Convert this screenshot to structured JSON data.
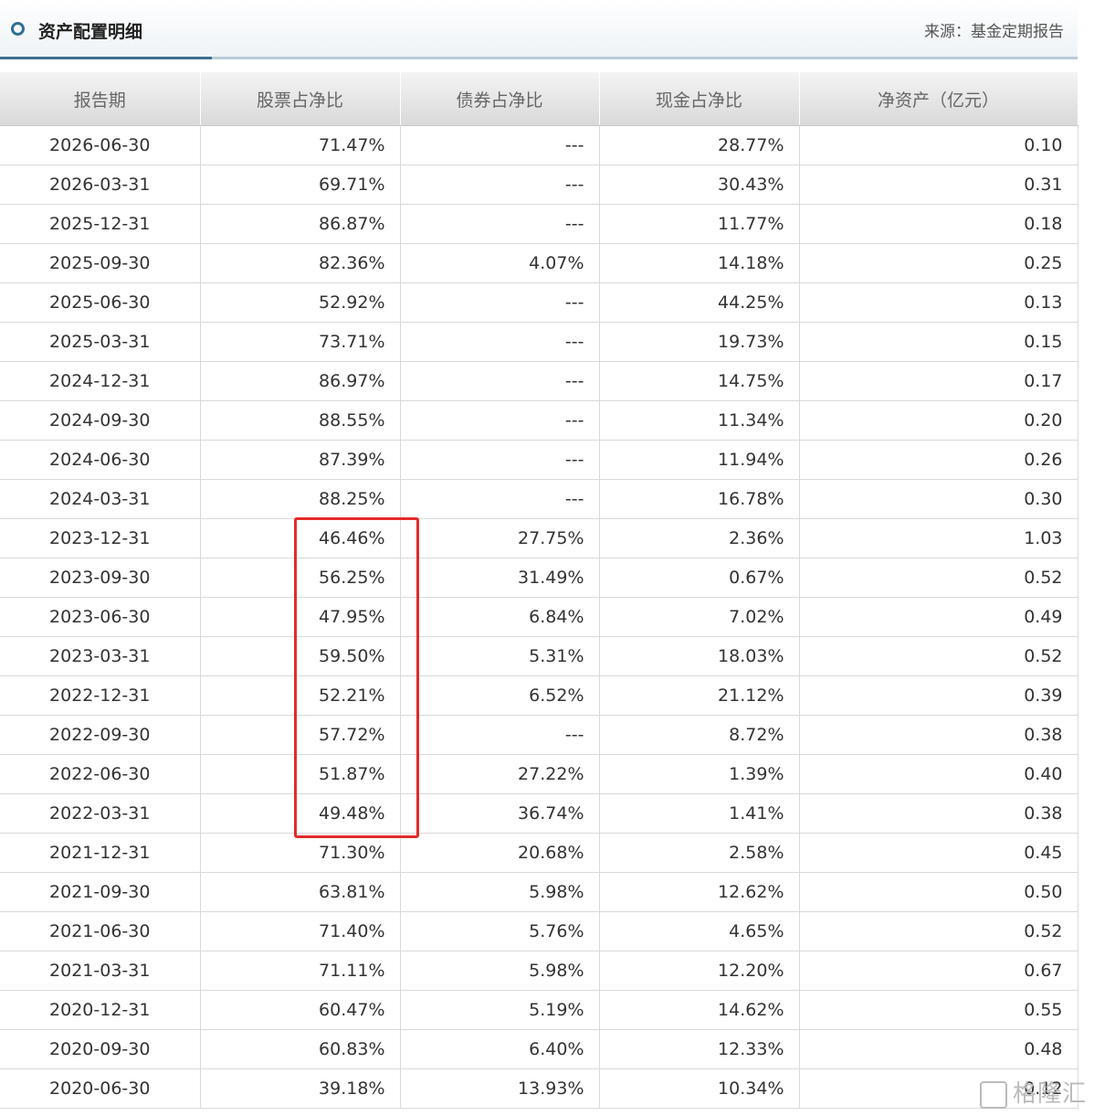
{
  "header": {
    "title": "资产配置明细",
    "source": "来源：基金定期报告"
  },
  "table": {
    "columns": [
      "报告期",
      "股票占净比",
      "债券占净比",
      "现金占净比",
      "净资产（亿元）"
    ],
    "rows": [
      [
        "2026-06-30",
        "71.47%",
        "---",
        "28.77%",
        "0.10"
      ],
      [
        "2026-03-31",
        "69.71%",
        "---",
        "30.43%",
        "0.31"
      ],
      [
        "2025-12-31",
        "86.87%",
        "---",
        "11.77%",
        "0.18"
      ],
      [
        "2025-09-30",
        "82.36%",
        "4.07%",
        "14.18%",
        "0.25"
      ],
      [
        "2025-06-30",
        "52.92%",
        "---",
        "44.25%",
        "0.13"
      ],
      [
        "2025-03-31",
        "73.71%",
        "---",
        "19.73%",
        "0.15"
      ],
      [
        "2024-12-31",
        "86.97%",
        "---",
        "14.75%",
        "0.17"
      ],
      [
        "2024-09-30",
        "88.55%",
        "---",
        "11.34%",
        "0.20"
      ],
      [
        "2024-06-30",
        "87.39%",
        "---",
        "11.94%",
        "0.26"
      ],
      [
        "2024-03-31",
        "88.25%",
        "---",
        "16.78%",
        "0.30"
      ],
      [
        "2023-12-31",
        "46.46%",
        "27.75%",
        "2.36%",
        "1.03"
      ],
      [
        "2023-09-30",
        "56.25%",
        "31.49%",
        "0.67%",
        "0.52"
      ],
      [
        "2023-06-30",
        "47.95%",
        "6.84%",
        "7.02%",
        "0.49"
      ],
      [
        "2023-03-31",
        "59.50%",
        "5.31%",
        "18.03%",
        "0.52"
      ],
      [
        "2022-12-31",
        "52.21%",
        "6.52%",
        "21.12%",
        "0.39"
      ],
      [
        "2022-09-30",
        "57.72%",
        "---",
        "8.72%",
        "0.38"
      ],
      [
        "2022-06-30",
        "51.87%",
        "27.22%",
        "1.39%",
        "0.40"
      ],
      [
        "2022-03-31",
        "49.48%",
        "36.74%",
        "1.41%",
        "0.38"
      ],
      [
        "2021-12-31",
        "71.30%",
        "20.68%",
        "2.58%",
        "0.45"
      ],
      [
        "2021-09-30",
        "63.81%",
        "5.98%",
        "12.62%",
        "0.50"
      ],
      [
        "2021-06-30",
        "71.40%",
        "5.76%",
        "4.65%",
        "0.52"
      ],
      [
        "2021-03-31",
        "71.11%",
        "5.98%",
        "12.20%",
        "0.67"
      ],
      [
        "2020-12-31",
        "60.47%",
        "5.19%",
        "14.62%",
        "0.55"
      ],
      [
        "2020-09-30",
        "60.83%",
        "6.40%",
        "12.33%",
        "0.48"
      ],
      [
        "2020-06-30",
        "39.18%",
        "13.93%",
        "10.34%",
        "0.12"
      ]
    ]
  },
  "highlight_color": "#e32b2b",
  "watermark": "格隆汇"
}
